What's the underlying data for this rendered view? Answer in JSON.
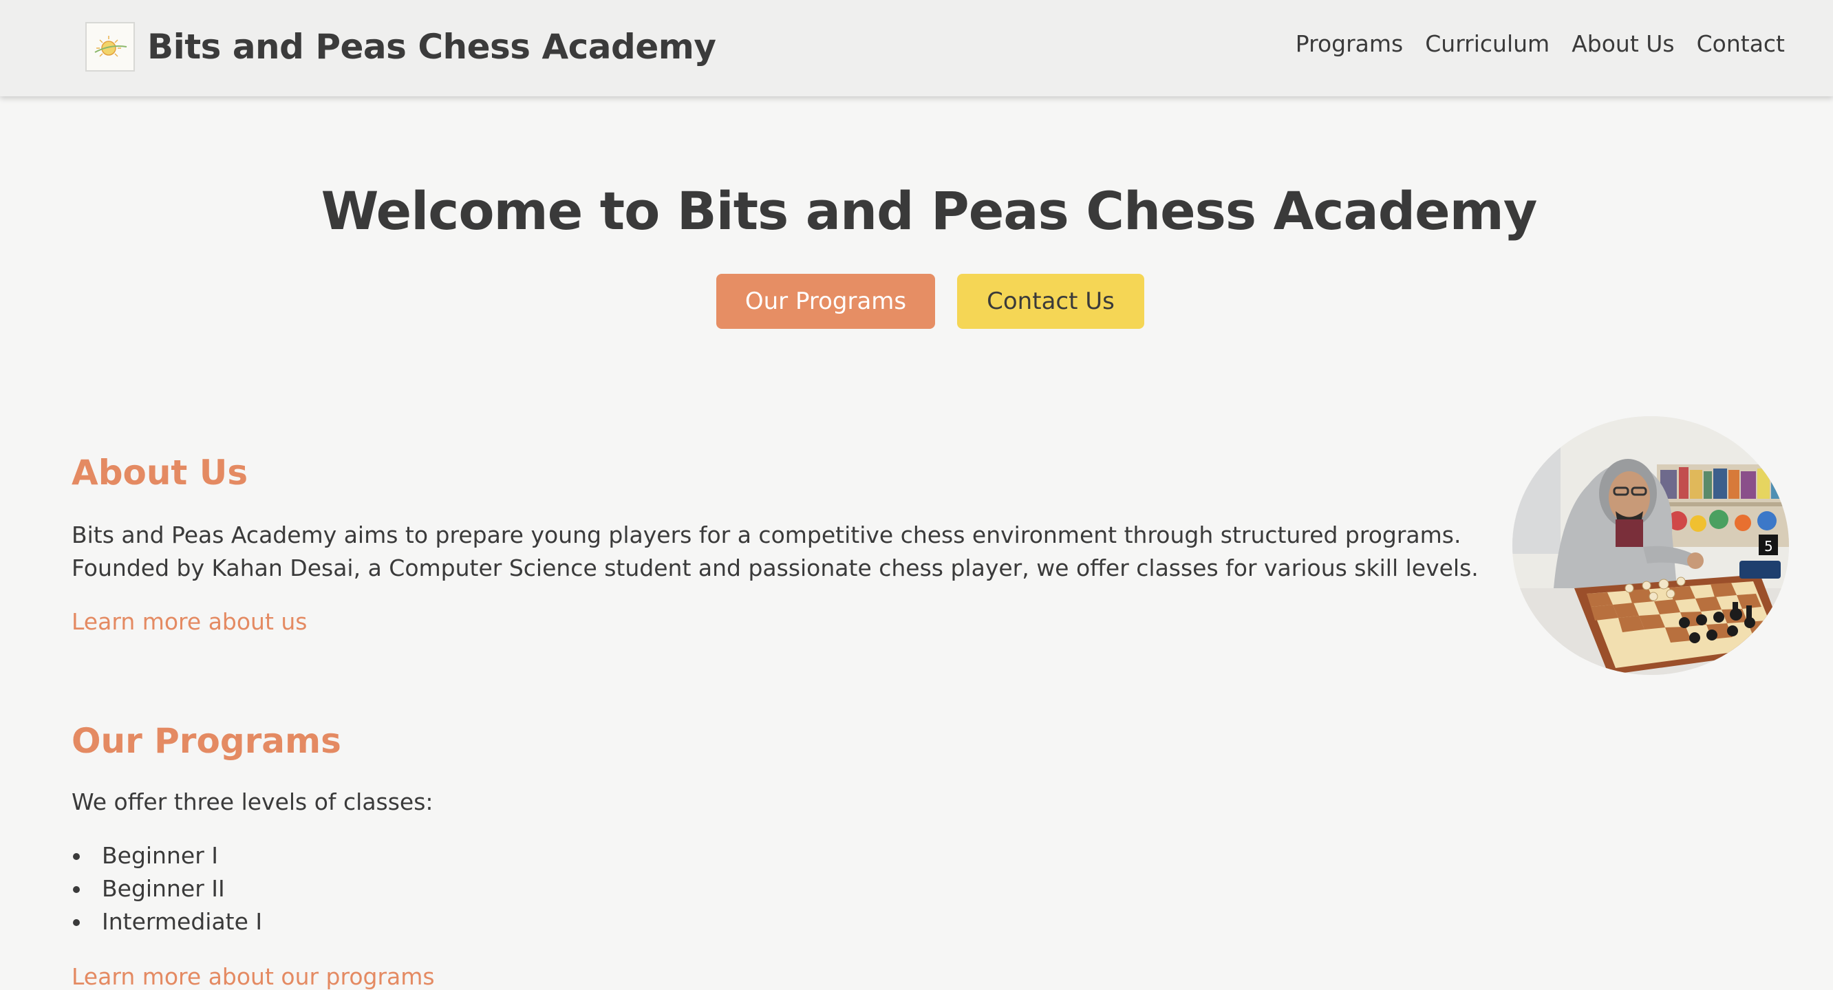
{
  "header": {
    "brand_name": "Bits and Peas Chess Academy",
    "nav": [
      {
        "label": "Programs"
      },
      {
        "label": "Curriculum"
      },
      {
        "label": "About Us"
      },
      {
        "label": "Contact"
      }
    ]
  },
  "hero": {
    "title": "Welcome to Bits and Peas Chess Academy",
    "primary_button": "Our Programs",
    "secondary_button": "Contact Us"
  },
  "about": {
    "heading": "About Us",
    "lines": [
      "Bits and Peas Academy aims to prepare young players for a competitive chess environment through structured programs.",
      "Founded by Kahan Desai, a Computer Science student and passionate chess player, we offer classes for various skill levels."
    ],
    "link": "Learn more about us"
  },
  "programs": {
    "heading": "Our Programs",
    "intro": "We offer three levels of classes:",
    "items": [
      "Beginner I",
      "Beginner II",
      "Intermediate I"
    ],
    "link": "Learn more about our programs"
  },
  "colors": {
    "accent": "#e48a62",
    "primary_button": "#e68e64",
    "secondary_button": "#f5d655",
    "background": "#f6f6f5",
    "header": "#efefee"
  },
  "icons": {
    "logo": "sun-logo-icon",
    "list_bullet": "bullet-dot"
  }
}
